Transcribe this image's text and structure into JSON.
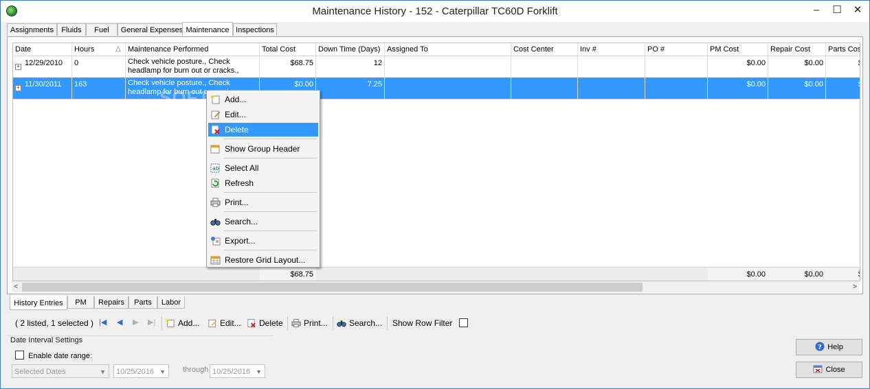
{
  "window": {
    "title": "Maintenance History - 152 - Caterpillar TC60D Forklift",
    "min": "–",
    "max": "☐",
    "close": "✕"
  },
  "top_tabs": [
    "Assignments",
    "Fluids",
    "Fuel",
    "General Expenses",
    "Maintenance",
    "Inspections"
  ],
  "active_top_tab": "Maintenance",
  "columns": [
    "Date",
    "Hours",
    "Maintenance Performed",
    "Total Cost",
    "Down Time (Days)",
    "Assigned To",
    "Cost Center",
    "Inv #",
    "PO #",
    "PM Cost",
    "Repair Cost",
    "Parts Cos"
  ],
  "sort_indicator": "△",
  "rows": [
    {
      "date": "12/29/2010",
      "hours": "0",
      "maintenance": "Check vehicle posture., Check headlamp for burn out or cracks.,",
      "total_cost": "$68.75",
      "down_time": "12",
      "pm_cost": "$0.00",
      "repair_cost": "$0.00",
      "parts_cost": "$",
      "selected": false
    },
    {
      "date": "11/30/2011",
      "hours": "163",
      "maintenance": "Check vehicle posture., Check headlamp for burn out or cracks.,",
      "total_cost": "$0.00",
      "down_time": "7.25",
      "pm_cost": "$0.00",
      "repair_cost": "$0.00",
      "parts_cost": "$",
      "selected": true
    }
  ],
  "totals": {
    "total_cost": "$68.75",
    "pm_cost": "$0.00",
    "repair_cost": "$0.00",
    "parts_cost": "$"
  },
  "context_menu": [
    {
      "label": "Add...",
      "icon": "add-icon"
    },
    {
      "label": "Edit...",
      "icon": "edit-icon"
    },
    {
      "label": "Delete",
      "icon": "delete-icon",
      "hover": true
    },
    {
      "label": "Show Group Header",
      "icon": "group-header-icon"
    },
    {
      "label": "Select All",
      "icon": "select-all-icon"
    },
    {
      "label": "Refresh",
      "icon": "refresh-icon"
    },
    {
      "label": "Print...",
      "icon": "print-icon"
    },
    {
      "label": "Search...",
      "icon": "search-icon"
    },
    {
      "label": "Export...",
      "icon": "export-icon"
    },
    {
      "label": "Restore Grid Layout...",
      "icon": "grid-layout-icon"
    }
  ],
  "watermark": "SOFTPEDIA",
  "bottom_tabs": [
    "History Entries",
    "PM",
    "Repairs",
    "Parts",
    "Labor"
  ],
  "active_bottom_tab": "History Entries",
  "toolbar": {
    "status": "( 2 listed, 1 selected )",
    "add": "Add...",
    "edit": "Edit...",
    "delete": "Delete",
    "print": "Print...",
    "search": "Search...",
    "row_filter": "Show Row Filter"
  },
  "date_interval": {
    "title": "Date Interval Settings",
    "enable": "Enable date range:",
    "mode": "Selected Dates",
    "from": "10/25/2016",
    "through": "through",
    "to": "10/25/2016"
  },
  "buttons": {
    "help": "Help",
    "close": "Close"
  },
  "colors": {
    "selection": "#3399ff",
    "window_border": "#3a7fc4"
  }
}
